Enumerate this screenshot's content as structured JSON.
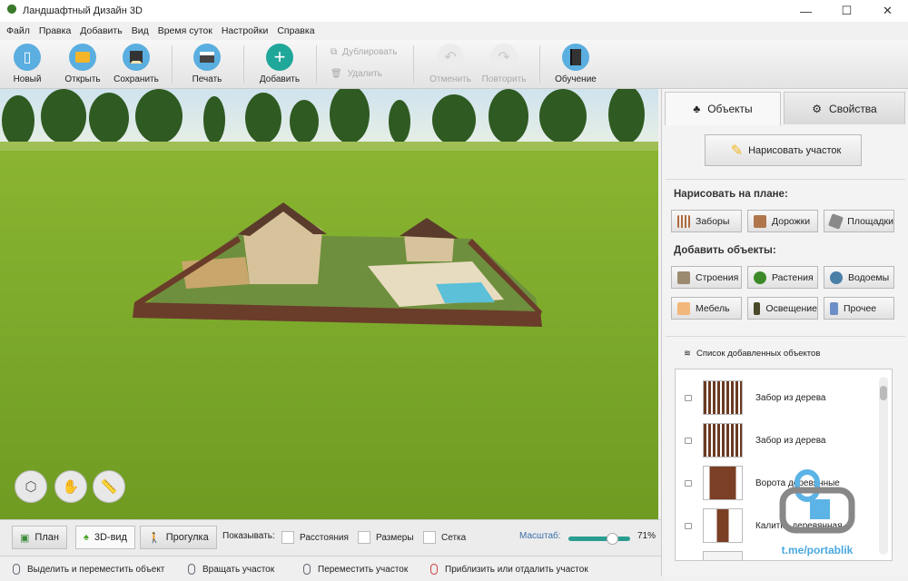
{
  "window": {
    "title": "Ландшафтный Дизайн 3D"
  },
  "menu": [
    "Файл",
    "Правка",
    "Добавить",
    "Вид",
    "Время суток",
    "Настройки",
    "Справка"
  ],
  "toolbar": {
    "new": "Новый",
    "open": "Открыть",
    "save": "Сохранить",
    "print": "Печать",
    "add": "Добавить",
    "duplicate": "Дублировать",
    "delete": "Удалить",
    "undo": "Отменить",
    "redo": "Повторить",
    "learn": "Обучение"
  },
  "panel": {
    "tabs": [
      "Объекты",
      "Свойства"
    ],
    "draw_plot": "Нарисовать участок",
    "draw_on_plan_label": "Нарисовать на плане:",
    "draw_items": [
      "Заборы",
      "Дорожки",
      "Площадки"
    ],
    "add_objects_label": "Добавить объекты:",
    "add_items": [
      "Строения",
      "Растения",
      "Водоемы",
      "Мебель",
      "Освещение",
      "Прочее"
    ],
    "list_title": "Список добавленных объектов",
    "list": [
      "Забор из дерева",
      "Забор из дерева",
      "Ворота деревянные",
      "Калитка деревянная"
    ]
  },
  "bottom": {
    "views": [
      "План",
      "3D-вид",
      "Прогулка"
    ],
    "show_label": "Показывать:",
    "options": [
      "Расстояния",
      "Размеры",
      "Сетка"
    ],
    "scale_label": "Масштаб:",
    "scale_value": "71%",
    "scale_fraction": 0.71
  },
  "status": [
    "Выделить и переместить объект",
    "Вращать участок",
    "Переместить участок",
    "Приблизить или отдалить участок"
  ],
  "watermark": "t.me/portablik"
}
